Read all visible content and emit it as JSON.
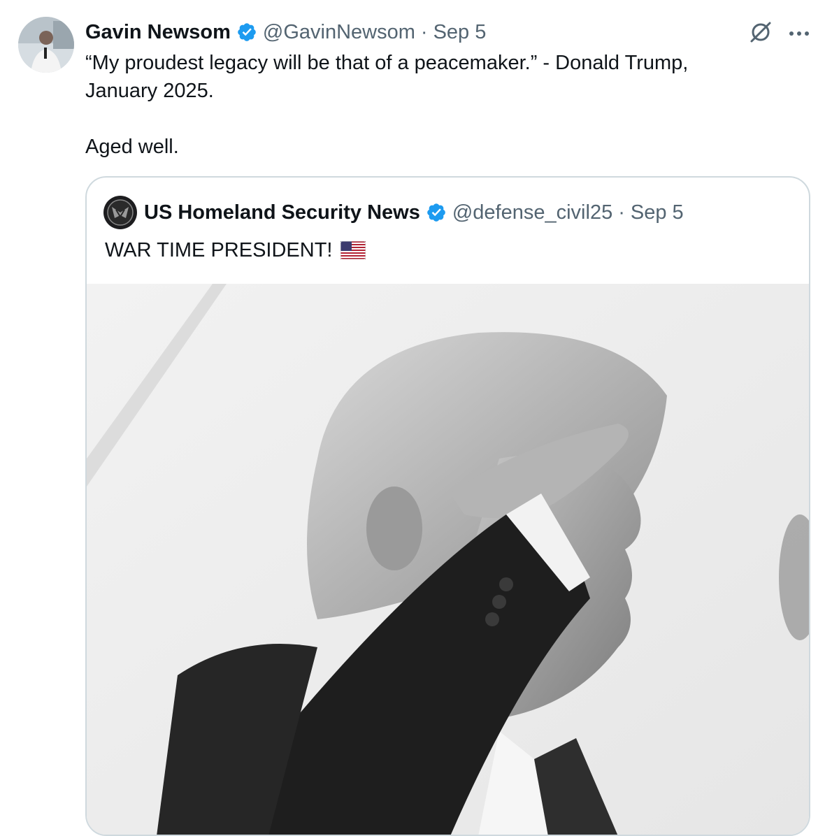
{
  "tweet": {
    "author_name": "Gavin Newsom",
    "author_handle": "@GavinNewsom",
    "separator": "·",
    "date": "Sep 5",
    "text_line1": "“My proudest legacy will be that of a peacemaker.” - Donald Trump, January 2025.",
    "text_line2": "Aged well.",
    "icons": {
      "verified": "verified-badge-icon",
      "grok": "grok-icon",
      "more": "more-options-icon"
    }
  },
  "quote": {
    "author_name": "US Homeland Security News",
    "author_handle": "@defense_civil25",
    "separator": "·",
    "date": "Sep 5",
    "text": "WAR TIME PRESIDENT!",
    "emoji": "us-flag-emoji",
    "media": "black-and-white photo of a man in a suit saluting"
  },
  "colors": {
    "verified_blue": "#1d9bf0",
    "meta_gray": "#536471",
    "border": "#cfd9de",
    "text": "#0f1419"
  }
}
